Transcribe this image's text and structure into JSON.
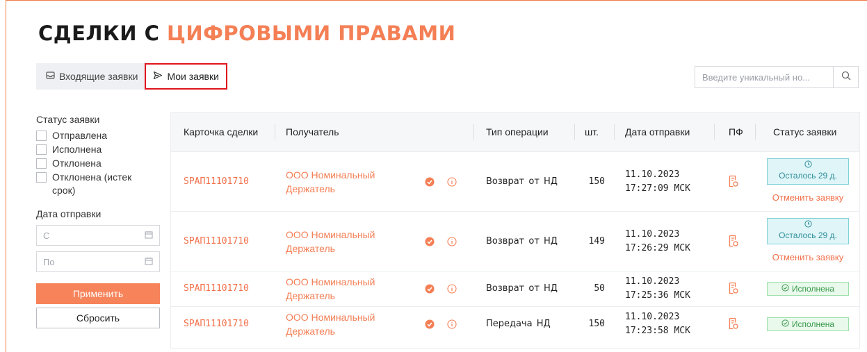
{
  "title": {
    "part1": "СДЕЛКИ С",
    "part2": "ЦИФРОВЫМИ ПРАВАМИ"
  },
  "tabs": [
    {
      "label": "Входящие заявки",
      "icon": "inbox-icon"
    },
    {
      "label": "Мои заявки",
      "icon": "send-icon"
    }
  ],
  "search": {
    "placeholder": "Введите уникальный но...",
    "value": ""
  },
  "filters": {
    "status_label": "Статус заявки",
    "statuses": [
      "Отправлена",
      "Исполнена",
      "Отклонена",
      "Отклонена (истек срок)"
    ],
    "date_label": "Дата отправки",
    "from_placeholder": "С",
    "to_placeholder": "По",
    "apply": "Применить",
    "reset": "Сбросить"
  },
  "table": {
    "headers": [
      "Карточка сделки",
      "Получатель",
      "Тип операции",
      "шт.",
      "Дата отправки",
      "ПФ",
      "Статус заявки"
    ],
    "rows": [
      {
        "card": "SPAП11101710",
        "recipient": "ООО Номинальный Держатель",
        "operation": "Возврат от НД",
        "qty": "150",
        "date": "11.10.2023",
        "time": "17:27:09 МСК",
        "status": "Осталось 29 д.",
        "status_type": "remaining",
        "action": "Отменить заявку"
      },
      {
        "card": "SPAП11101710",
        "recipient": "ООО Номинальный Держатель",
        "operation": "Возврат от НД",
        "qty": "149",
        "date": "11.10.2023",
        "time": "17:26:29 МСК",
        "status": "Осталось 29 д.",
        "status_type": "remaining",
        "action": "Отменить заявку"
      },
      {
        "card": "SPAП11101710",
        "recipient": "ООО Номинальный Держатель",
        "operation": "Возврат от НД",
        "qty": "50",
        "date": "11.10.2023",
        "time": "17:25:36 МСК",
        "status": "Исполнена",
        "status_type": "done",
        "action": ""
      },
      {
        "card": "SPAП11101710",
        "recipient": "ООО Номинальный Держатель",
        "operation": "Передача НД",
        "qty": "150",
        "date": "11.10.2023",
        "time": "17:23:58 МСК",
        "status": "Исполнена",
        "status_type": "done",
        "action": ""
      }
    ]
  },
  "colors": {
    "accent": "#f47f55",
    "highlight_border": "#e0131b",
    "remaining_bg": "#dff5f7",
    "done_bg": "#e9f9ec"
  }
}
